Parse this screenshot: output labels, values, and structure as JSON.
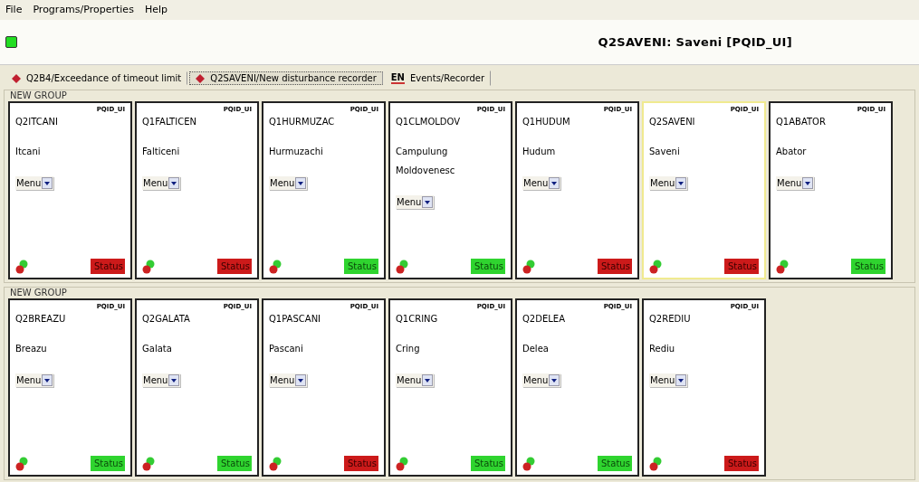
{
  "menu": [
    "File",
    "Programs/Properties",
    "Help"
  ],
  "toolbar": {
    "connected": true,
    "title": "Q2SAVENI: Saveni [PQID_UI]"
  },
  "tabs": [
    {
      "kind": "alarm",
      "label": "Q2B4/Exceedance of timeout limit",
      "selected": false
    },
    {
      "kind": "alarm",
      "label": "Q2SAVENI/New disturbance recorder",
      "selected": true
    },
    {
      "kind": "language",
      "lang": "EN",
      "label": "Events/Recorder",
      "selected": false
    }
  ],
  "groups": [
    {
      "title": "NEW GROUP",
      "cards": [
        {
          "tag": "PQID_UI",
          "code": "Q2ITCANI",
          "name_lines": [
            "Itcani"
          ],
          "menu": "Menu",
          "status": "Status",
          "status_ok": false,
          "selected": false
        },
        {
          "tag": "PQID_UI",
          "code": "Q1FALTICEN",
          "name_lines": [
            "Falticeni"
          ],
          "menu": "Menu",
          "status": "Status",
          "status_ok": false,
          "selected": false
        },
        {
          "tag": "PQID_UI",
          "code": "Q1HURMUZAC",
          "name_lines": [
            "Hurmuzachi"
          ],
          "menu": "Menu",
          "status": "Status",
          "status_ok": true,
          "selected": false
        },
        {
          "tag": "PQID_UI",
          "code": "Q1CLMOLDOV",
          "name_lines": [
            "Campulung",
            "Moldovenesc"
          ],
          "menu": "Menu",
          "status": "Status",
          "status_ok": true,
          "selected": false
        },
        {
          "tag": "PQID_UI",
          "code": "Q1HUDUM",
          "name_lines": [
            "Hudum"
          ],
          "menu": "Menu",
          "status": "Status",
          "status_ok": false,
          "selected": false
        },
        {
          "tag": "PQID_UI",
          "code": "Q2SAVENI",
          "name_lines": [
            "Saveni"
          ],
          "menu": "Menu",
          "status": "Status",
          "status_ok": false,
          "selected": true
        },
        {
          "tag": "PQID_UI",
          "code": "Q1ABATOR",
          "name_lines": [
            "Abator"
          ],
          "menu": "Menu",
          "status": "Status",
          "status_ok": true,
          "selected": false
        }
      ]
    },
    {
      "title": "NEW GROUP",
      "cards": [
        {
          "tag": "PQID_UI",
          "code": "Q2BREAZU",
          "name_lines": [
            "Breazu"
          ],
          "menu": "Menu",
          "status": "Status",
          "status_ok": true,
          "selected": false
        },
        {
          "tag": "PQID_UI",
          "code": "Q2GALATA",
          "name_lines": [
            "Galata"
          ],
          "menu": "Menu",
          "status": "Status",
          "status_ok": true,
          "selected": false
        },
        {
          "tag": "PQID_UI",
          "code": "Q1PASCANI",
          "name_lines": [
            "Pascani"
          ],
          "menu": "Menu",
          "status": "Status",
          "status_ok": false,
          "selected": false
        },
        {
          "tag": "PQID_UI",
          "code": "Q1CRING",
          "name_lines": [
            "Cring"
          ],
          "menu": "Menu",
          "status": "Status",
          "status_ok": true,
          "selected": false
        },
        {
          "tag": "PQID_UI",
          "code": "Q2DELEA",
          "name_lines": [
            "Delea"
          ],
          "menu": "Menu",
          "status": "Status",
          "status_ok": true,
          "selected": false
        },
        {
          "tag": "PQID_UI",
          "code": "Q2REDIU",
          "name_lines": [
            "Rediu"
          ],
          "menu": "Menu",
          "status": "Status",
          "status_ok": false,
          "selected": false
        }
      ]
    }
  ]
}
